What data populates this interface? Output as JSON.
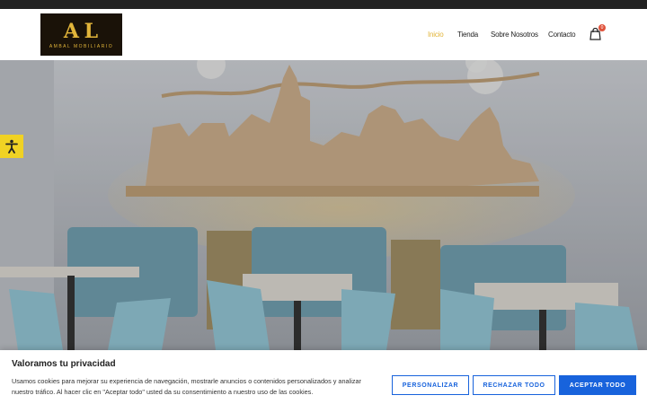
{
  "header": {
    "logo_mark": "A L",
    "logo_sub": "AMBAL MOBILIARIO",
    "nav": [
      "Inicio",
      "Tienda",
      "Sobre Nosotros",
      "Contacto"
    ],
    "cart_count": "0"
  },
  "colors": {
    "accent": "#e2b53a",
    "cookie_button": "#1863dc",
    "a11y": "#f0d224"
  },
  "cookie": {
    "title": "Valoramos tu privacidad",
    "text": "Usamos cookies para mejorar su experiencia de navegación, mostrarle anuncios o contenidos personalizados y analizar nuestro tráfico. Al hacer clic en \"Aceptar todo\" usted da su consentimiento a nuestro uso de las cookies.",
    "customize": "PERSONALIZAR",
    "reject": "RECHAZAR TODO",
    "accept": "ACEPTAR TODO"
  }
}
